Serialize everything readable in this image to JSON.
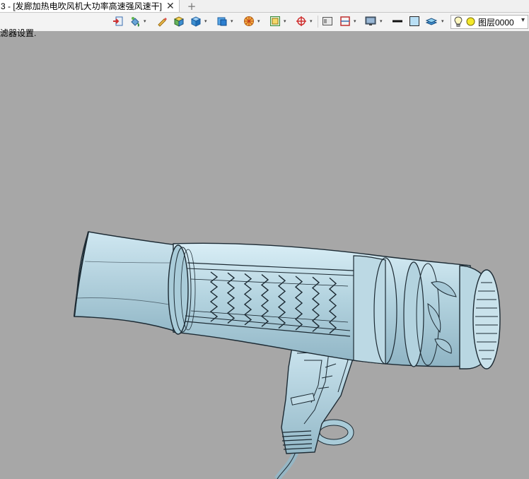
{
  "tab": {
    "title": "3 - [发廊加热电吹风机大功率高速强风速干]",
    "close_glyph": "✕",
    "add_glyph": "+"
  },
  "toolbar": {
    "buttons": [
      {
        "name": "import-icon"
      },
      {
        "name": "paint-bucket-icon"
      },
      {
        "name": "pen-icon"
      },
      {
        "name": "box-shaded-icon"
      },
      {
        "name": "box-blue-icon"
      },
      {
        "name": "view-cube-icon"
      },
      {
        "name": "render-wheel-icon"
      },
      {
        "name": "zoom-frame-icon"
      },
      {
        "name": "center-axis-icon"
      },
      {
        "name": "window-icon"
      },
      {
        "name": "section-icon"
      },
      {
        "name": "monitor-icon"
      },
      {
        "name": "line-width-icon"
      },
      {
        "name": "color-swatch-icon"
      },
      {
        "name": "layers-icon"
      }
    ],
    "layer_current": "图层0000"
  },
  "status_text": "滤器设置.",
  "colors": {
    "background": "#a7a7a7",
    "model_fill": "#b7d4e0",
    "model_stroke": "#1c2a33",
    "toolbar_bg": "#f3f3f3"
  }
}
